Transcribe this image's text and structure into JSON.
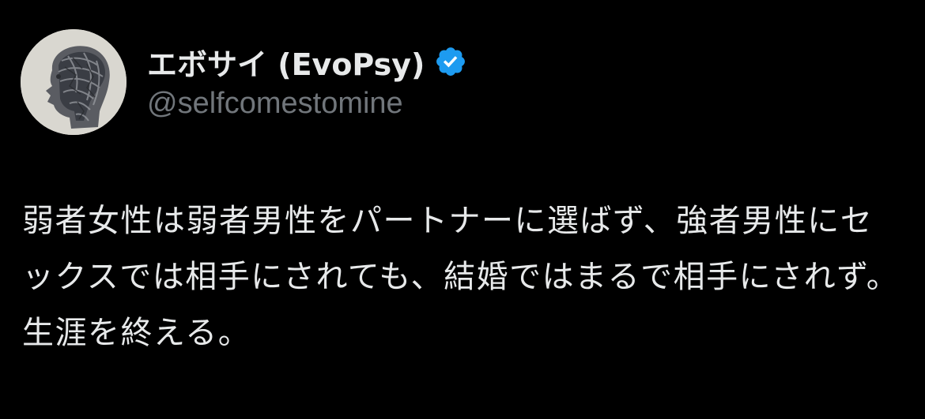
{
  "author": {
    "display_name": "エボサイ (EvoPsy)",
    "handle": "@selfcomestomine",
    "verified": true,
    "avatar_icon": "sculpted-head-avatar",
    "verified_badge_color": "#1d9bf0"
  },
  "tweet": {
    "text": "弱者女性は弱者男性をパートナーに選ばず、強者男性にセックスでは相手にされても、結婚ではまるで相手にされず。生涯を終える。"
  },
  "colors": {
    "background": "#000000",
    "primary_text": "#e7e9ea",
    "secondary_text": "#71767b"
  }
}
